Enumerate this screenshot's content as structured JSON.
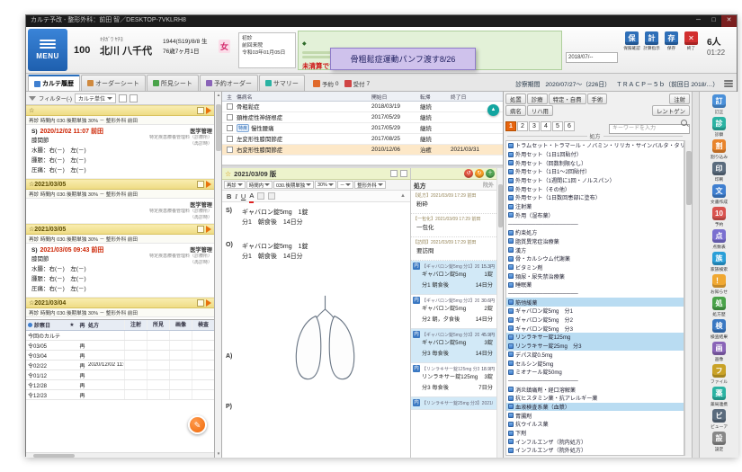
{
  "titlebar": {
    "title": "カルテ予改 - 整形外科：前田 智／DESKTOP-7VKLRH8",
    "minimize": "─",
    "maximize": "□",
    "close": "✕"
  },
  "header": {
    "menu_label": "MENU",
    "patient": {
      "id": "100",
      "kana": "ｷﾀｶﾞﾜ ﾔﾁﾖ",
      "name": "北川 八千代",
      "birth": "1944(S19)/8/8 生",
      "age": "76歳7ヶ月1日",
      "sex": "女"
    },
    "visit": {
      "first_label": "初診",
      "last_label": "前回来院",
      "last_value": "令和03年01月05日"
    },
    "memo": {
      "mark": "◆",
      "alert": "未清算です。"
    },
    "tooltip": "骨粗鬆症運動パンフ渡す8/26",
    "date_field": "2018/07/--",
    "buttons": [
      {
        "label": "保険確認",
        "glyph": "保",
        "color": "#2e6fb8"
      },
      {
        "label": "計算指示",
        "glyph": "計",
        "color": "#2e6fb8"
      },
      {
        "label": "保存",
        "glyph": "存",
        "color": "#2e6fb8"
      },
      {
        "label": "終了",
        "glyph": "✕",
        "color": "#d22f2f"
      }
    ],
    "waiting": "6人",
    "clock": "01:22"
  },
  "toolbar": {
    "tabs": [
      {
        "label": "カルテ履歴",
        "active": true,
        "color": "#3f7fd0"
      },
      {
        "label": "オーダーシート",
        "active": false,
        "color": "#d08a3f"
      },
      {
        "label": "所見シート",
        "active": false,
        "color": "#4aa34a"
      },
      {
        "label": "予約オーダー",
        "active": false,
        "color": "#8a64b8"
      },
      {
        "label": "サマリー",
        "active": false,
        "color": "#2bb3a3"
      }
    ],
    "counters": [
      {
        "label": "予約",
        "value": "0",
        "color": "#e06a2c"
      },
      {
        "label": "受付",
        "value": "7",
        "color": "#d04545"
      }
    ],
    "period_label": "診察期間",
    "period_value": "2020/07/27～（226日）",
    "tracp": "ＴＲＡＣＰ－５ｂ（前回日 2018/…）"
  },
  "karte": {
    "filter_label": "フィルター(-)",
    "unit_select": "カルテ単位",
    "memo_button": "✎",
    "entries": [
      {
        "bar": "☆",
        "sub": "再診 時間内 030.後期単独 30% － 整形外科 前田",
        "soap": "S)",
        "datetime": "2020/12/02 11:07 前田",
        "tag": "医学管理",
        "lines": [
          "膝関節",
          "水腫：右(－)　左(－)",
          "腫脹：右(－)　左(－)",
          "圧痛：右(－)　左(－)"
        ],
        "notes": [
          "特定疾患療養管理料（診療所）",
          "（再診時）"
        ]
      },
      {
        "bar": "☆2021/03/05",
        "sub": "再診 時間内 030.後期単独 30% － 整形外科 前田",
        "soap": "",
        "datetime": "",
        "tag": "医学管理",
        "lines": [],
        "notes": [
          "特定疾患療養管理料（診療所）",
          "（再診時）"
        ]
      },
      {
        "bar": "☆2021/03/05",
        "sub": "再診 時間内 030.後期単独 30% － 整形外科 前田",
        "soap": "S)",
        "datetime": "2021/03/05 09:43 前田",
        "tag": "医学管理",
        "lines": [
          "膝関節",
          "水腫：右(－)　左(－)",
          "腫脹：右(－)　左(－)",
          "圧痛：右(－)　左(－)"
        ],
        "notes": [
          "特定疾患療養管理料（診療所）",
          "（再診時）"
        ]
      },
      {
        "bar": "☆2021/03/04",
        "sub": "再診 時間内 030.後期単独 30% － 整形外科 前田",
        "soap": "",
        "datetime": "",
        "tag": "",
        "lines": [],
        "notes": []
      }
    ],
    "table": {
      "headers": [
        "診察日",
        "★",
        "再",
        "処方",
        "注射",
        "所見",
        "画像",
        "検査"
      ],
      "rows": [
        {
          "date": "今回のカルテ",
          "kind": "",
          "note": "",
          "pink": true
        },
        {
          "date": "令03/05",
          "kind": "再",
          "note": ""
        },
        {
          "date": "令03/04",
          "kind": "再",
          "note": ""
        },
        {
          "date": "令02/22",
          "kind": "再",
          "note": "2020/12/02 11:0"
        },
        {
          "date": "令01/12",
          "kind": "再",
          "note": ""
        },
        {
          "date": "令12/28",
          "kind": "再",
          "note": ""
        },
        {
          "date": "令12/23",
          "kind": "再",
          "note": ""
        }
      ]
    }
  },
  "diagnoses": {
    "scrolltop": "▲",
    "headers": [
      "主",
      "傷病名",
      "開始日",
      "転帰",
      "終了日"
    ],
    "rows": [
      {
        "tag": "",
        "name": "骨粗鬆症",
        "start": "2018/03/19",
        "outcome": "継続",
        "end": ""
      },
      {
        "tag": "",
        "name": "頚椎症性神経根症",
        "start": "2017/05/29",
        "outcome": "継続",
        "end": ""
      },
      {
        "tag": "特疾",
        "name": "慢性腰痛",
        "start": "2017/05/29",
        "outcome": "継続",
        "end": ""
      },
      {
        "tag": "",
        "name": "左変形性膝関節症",
        "start": "2017/08/25",
        "outcome": "継続",
        "end": ""
      },
      {
        "tag": "",
        "name": "右変形性膝関節症",
        "start": "2010/12/06",
        "outcome": "治癒",
        "end": "2021/03/31",
        "highlight": true
      }
    ]
  },
  "editor": {
    "star": "☆",
    "bar_date": "2021/03/09 版",
    "selects": [
      "再診",
      "時間内",
      "030.後期単独",
      "30%",
      "－",
      "整形外科"
    ],
    "format": [
      "B",
      "I",
      "U",
      "A"
    ],
    "soap": [
      {
        "label": "S)",
        "l1": "ギャバロン錠5mg　1錠",
        "l2": "分1　朝食後　14日分"
      },
      {
        "label": "O)",
        "l1": "ギャバロン錠5mg　1錠",
        "l2": "分1　朝食後　14日分"
      },
      {
        "label": "A)",
        "l1": "",
        "l2": ""
      },
      {
        "label": "P)",
        "l1": "",
        "l2": ""
      }
    ]
  },
  "rx": {
    "title": "処方",
    "mode": "院外",
    "actions": [
      {
        "glyph": "↺",
        "color": "#e05540"
      },
      {
        "glyph": "↻",
        "color": "#f59a23"
      },
      {
        "glyph": "＋",
        "color": "#52a352"
      }
    ],
    "comments": [
      {
        "head": "【処方】2021/03/09 17:29 前田",
        "body": "粉砕"
      },
      {
        "head": "【一包化】2021/03/09 17:29 前田",
        "body": "一包化"
      },
      {
        "head": "【訪問】2021/03/09 17:29 前田",
        "body": "要訪問"
      }
    ],
    "items": [
      {
        "badge": "内",
        "head": "【ギャバロン錠5mg 分1】2021/03/09 17…",
        "price": "15.3円",
        "drug": "ギャバロン錠5mg",
        "qty": "1錠",
        "usage": "分1 朝食後",
        "days": "14日分",
        "selected": true,
        "full": true
      },
      {
        "badge": "内",
        "head": "【ギャバロン錠5mg 分2】2021/03/09 17…",
        "price": "30.6円",
        "drug": "ギャバロン錠5mg",
        "qty": "2錠",
        "usage": "分2 朝，夕食後",
        "days": "14日分",
        "selected": false,
        "full": true
      },
      {
        "badge": "内",
        "head": "【ギャバロン錠5mg 分3】2021/03/09 17…",
        "price": "45.9円",
        "drug": "ギャバロン錠5mg",
        "qty": "3錠",
        "usage": "分3 毎食後",
        "days": "14日分",
        "selected": true,
        "full": true
      },
      {
        "badge": "内",
        "head": "【リンラキサー錠125mg 分3】2021/03/09 17…",
        "price": "18.9円",
        "drug": "リンラキサー錠125mg",
        "qty": "3錠",
        "usage": "分3 毎食後",
        "days": "7日分",
        "selected": false,
        "full": true
      },
      {
        "badge": "内",
        "head": "【リンラキサー錠25mg 分3】2021/03/0…",
        "price": "",
        "drug": "",
        "qty": "",
        "usage": "",
        "days": "",
        "selected": true,
        "full": false
      }
    ]
  },
  "master": {
    "tabs1": [
      "処置",
      "診療",
      "特定・自費",
      "手術"
    ],
    "tabs2": [
      "病名",
      "リハ用"
    ],
    "side1": "注射",
    "side2": "レントゲン",
    "pages": [
      {
        "n": "1",
        "active": true
      },
      {
        "n": "2"
      },
      {
        "n": "3"
      },
      {
        "n": "4"
      },
      {
        "n": "5"
      },
      {
        "n": "6"
      }
    ],
    "search_placeholder": "キーワードを入力",
    "section": "処方",
    "items": [
      {
        "text": "トラムセット・トラマール・ノバミン・リリカ・サインバルタ・タリージェ",
        "ic": true
      },
      {
        "text": "外用セット（1日1回貼付）",
        "ic": true
      },
      {
        "text": "外用セット（回数制限なし）",
        "ic": true
      },
      {
        "text": "外用セット（1日1～2回貼付）",
        "ic": true
      },
      {
        "text": "外用セット（1週間に1回・ノルスパン）",
        "ic": true
      },
      {
        "text": "外用セット（その他）",
        "ic": true
      },
      {
        "text": "外用セット（1日数回患部に塗布）",
        "ic": true
      },
      {
        "text": "注射薬",
        "ic": true
      },
      {
        "text": "外用（湿布薬）",
        "ic": true
      },
      {
        "text": "──────────────────",
        "sep": true
      },
      {
        "text": "約束処方",
        "ic": true
      },
      {
        "text": "脂質異常症治療薬",
        "ic": true
      },
      {
        "text": "漢方",
        "ic": true
      },
      {
        "text": "骨・カルシウム代謝薬",
        "ic": true
      },
      {
        "text": "ビタミン剤",
        "ic": true
      },
      {
        "text": "頻尿・尿失禁治療薬",
        "ic": true
      },
      {
        "text": "睡眠薬",
        "ic": true
      },
      {
        "text": "──────────────────",
        "sep": true
      },
      {
        "text": "筋弛緩薬",
        "ic": true,
        "sel": true
      },
      {
        "text": "ギャバロン錠5mg　分1",
        "ic": true
      },
      {
        "text": "ギャバロン錠5mg　分2",
        "ic": true
      },
      {
        "text": "ギャバロン錠5mg　分3",
        "ic": true
      },
      {
        "text": "リンラキサー錠125mg",
        "ic": true,
        "sel": true
      },
      {
        "text": "リンラキサー錠25mg　分3",
        "ic": true,
        "sel": true
      },
      {
        "text": "デパス錠0.5mg",
        "ic": true
      },
      {
        "text": "セルシン錠5mg",
        "ic": true
      },
      {
        "text": "ミオナール錠50mg",
        "ic": true
      },
      {
        "text": "──────────────────",
        "sep": true
      },
      {
        "text": "消炎鎮痛剤・経口溶解薬",
        "ic": true
      },
      {
        "text": "抗ヒスタミン薬・抗アレルギー薬",
        "ic": true
      },
      {
        "text": "血液検査系薬（血漿）",
        "ic": true,
        "sel": true
      },
      {
        "text": "胃腸剤",
        "ic": true
      },
      {
        "text": "抗ウイルス薬",
        "ic": true
      },
      {
        "text": "下剤",
        "ic": true
      },
      {
        "text": "インフルエンザ（院内処方）",
        "ic": true
      },
      {
        "text": "インフルエンザ（院外処方）",
        "ic": true
      }
    ]
  },
  "sidebar": {
    "items": [
      {
        "label": "訂正",
        "glyph": "訂",
        "color": "#4a90d9"
      },
      {
        "label": "診察",
        "glyph": "診",
        "color": "#2bb3a3"
      },
      {
        "label": "割り込み",
        "glyph": "割",
        "color": "#e8842c"
      },
      {
        "label": "印刷",
        "glyph": "印",
        "color": "#5a6b7d"
      },
      {
        "label": "文書作成",
        "glyph": "文",
        "color": "#3f7fd0"
      },
      {
        "label": "予約",
        "glyph": "10",
        "color": "#d9534f"
      },
      {
        "label": "点数表",
        "glyph": "点",
        "color": "#7a6fd0"
      },
      {
        "label": "家族検索",
        "glyph": "族",
        "color": "#2a9fd8"
      },
      {
        "label": "お知らせ",
        "glyph": "！",
        "color": "#f0a832"
      },
      {
        "label": "処方歴",
        "glyph": "処",
        "color": "#4aa34a"
      },
      {
        "label": "検査結果",
        "glyph": "検",
        "color": "#3a78c2"
      },
      {
        "label": "画像",
        "glyph": "画",
        "color": "#8a64b8"
      },
      {
        "label": "ファイル",
        "glyph": "フ",
        "color": "#c9a227"
      },
      {
        "label": "薬局連携",
        "glyph": "薬",
        "color": "#2bb3a3"
      },
      {
        "label": "ビューア",
        "glyph": "ビ",
        "color": "#5a6b7d"
      },
      {
        "label": "設定",
        "glyph": "設",
        "color": "#888888"
      }
    ]
  }
}
